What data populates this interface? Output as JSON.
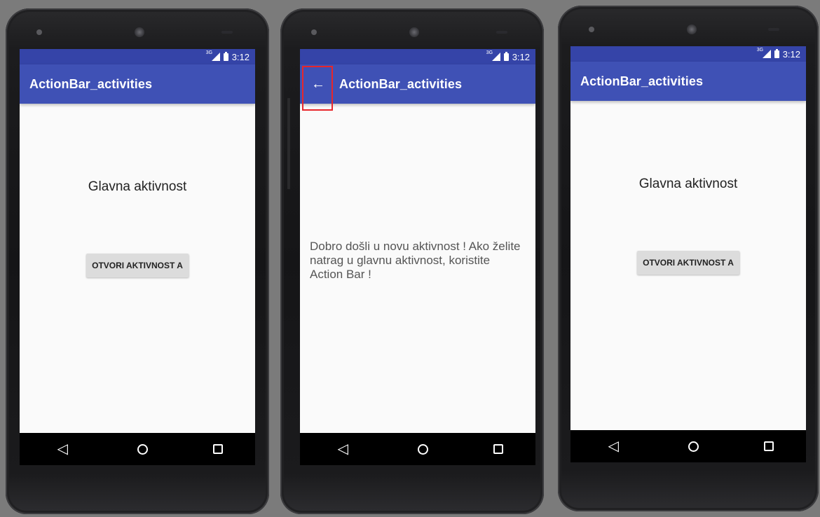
{
  "screens": [
    {
      "status_time": "3:12",
      "network": "3G",
      "app_title": "ActionBar_activities",
      "heading": "Glavna aktivnost",
      "button_label": "OTVORI AKTIVNOST A"
    },
    {
      "status_time": "3:12",
      "network": "3G",
      "app_title": "ActionBar_activities",
      "back_icon": "arrow-back-icon",
      "body_text": "Dobro došli u novu aktivnost ! Ako želite natrag u glavnu aktivnost, koristite Action Bar !"
    },
    {
      "status_time": "3:12",
      "network": "3G",
      "app_title": "ActionBar_activities",
      "heading": "Glavna aktivnost",
      "button_label": "OTVORI AKTIVNOST A"
    }
  ],
  "nav_icons": [
    "back-triangle-icon",
    "home-circle-icon",
    "recents-square-icon"
  ],
  "colors": {
    "action_bar": "#3f51b5",
    "status_bar": "#3544a8",
    "highlight": "#e8262a"
  }
}
